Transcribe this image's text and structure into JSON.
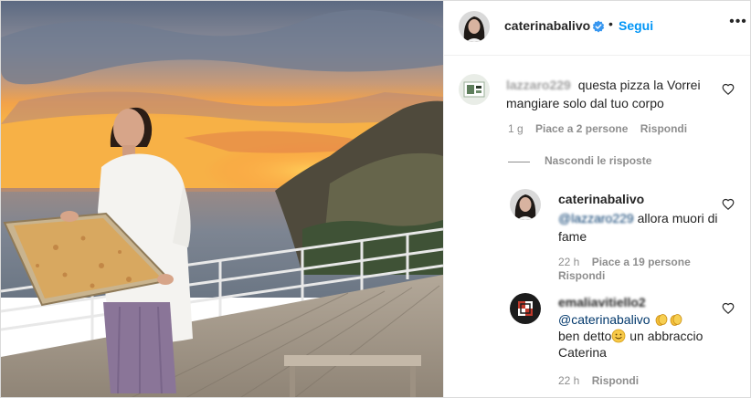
{
  "post": {
    "author": "caterinabalivo",
    "follow_label": "Segui",
    "separator": "•",
    "more_label": "•••"
  },
  "comment": {
    "user": "lazzaro229",
    "text": "questa pizza la Vorrei mangiare solo dal tuo corpo",
    "time": "1 g",
    "likes": "Piace a 2 persone",
    "reply_label": "Rispondi"
  },
  "replies_toggle": {
    "label": "Nascondi le risposte"
  },
  "replies": [
    {
      "user": "caterinabalivo",
      "mention": "@lazzaro229",
      "text": "allora muori di fame",
      "time": "22 h",
      "likes": "Piace a 19 persone",
      "reply_label": "Rispondi"
    },
    {
      "user": "emaliavitiello2",
      "mention": "@caterinabalivo",
      "text_1": "ben detto",
      "text_2": "un abbraccio Caterina",
      "time": "22 h",
      "reply_label": "Rispondi"
    }
  ],
  "icons": {
    "verified": "verified-badge-icon",
    "heart": "heart-outline-icon",
    "clap": "clapping-hands-emoji",
    "smile": "smiling-face-emoji"
  },
  "colors": {
    "link_blue": "#0095f6",
    "mention_blue": "#00376b",
    "muted": "#8e8e8e",
    "text": "#262626"
  }
}
